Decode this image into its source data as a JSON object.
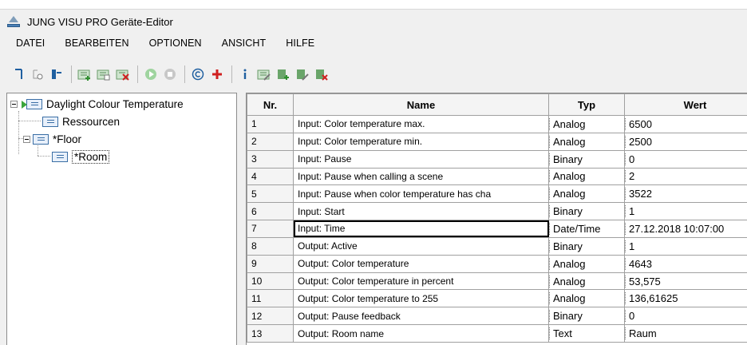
{
  "window": {
    "title": "JUNG VISU PRO Geräte-Editor"
  },
  "menu": [
    "DATEI",
    "BEARBEITEN",
    "OPTIONEN",
    "ANSICHT",
    "HILFE"
  ],
  "toolbar": {
    "icons": [
      "new-item-icon",
      "import-icon",
      "export-icon",
      "add-icon",
      "copy-icon",
      "delete-icon",
      "play-icon",
      "stop-icon",
      "copyright-icon",
      "plus-red-icon",
      "info-icon",
      "edit-icon",
      "add-green-icon",
      "edit-green-icon",
      "remove-green-icon"
    ]
  },
  "tree": {
    "root": "Daylight Colour Temperature",
    "ressourcen": "Ressourcen",
    "floor": "*Floor",
    "room": "*Room"
  },
  "grid": {
    "columns": [
      "Nr.",
      "Name",
      "Typ",
      "Wert"
    ],
    "rows": [
      {
        "nr": "1",
        "name": "Input: Color temperature max.",
        "typ": "Analog",
        "wert": "6500"
      },
      {
        "nr": "2",
        "name": "Input: Color temperature min.",
        "typ": "Analog",
        "wert": "2500"
      },
      {
        "nr": "3",
        "name": "Input: Pause",
        "typ": "Binary",
        "wert": "0"
      },
      {
        "nr": "4",
        "name": "Input: Pause when calling a scene",
        "typ": "Analog",
        "wert": "2"
      },
      {
        "nr": "5",
        "name": "Input: Pause when color temperature has cha",
        "typ": "Analog",
        "wert": "3522"
      },
      {
        "nr": "6",
        "name": "Input: Start",
        "typ": "Binary",
        "wert": "1"
      },
      {
        "nr": "7",
        "name": "Input: Time",
        "typ": "Date/Time",
        "wert": "27.12.2018 10:07:00"
      },
      {
        "nr": "8",
        "name": "Output: Active",
        "typ": "Binary",
        "wert": "1"
      },
      {
        "nr": "9",
        "name": "Output: Color temperature",
        "typ": "Analog",
        "wert": "4643"
      },
      {
        "nr": "10",
        "name": "Output: Color temperature in percent",
        "typ": "Analog",
        "wert": "53,575"
      },
      {
        "nr": "11",
        "name": "Output: Color temperature to 255",
        "typ": "Analog",
        "wert": "136,61625"
      },
      {
        "nr": "12",
        "name": "Output: Pause feedback",
        "typ": "Binary",
        "wert": "0"
      },
      {
        "nr": "13",
        "name": "Output: Room name",
        "typ": "Text",
        "wert": "Raum"
      }
    ]
  }
}
